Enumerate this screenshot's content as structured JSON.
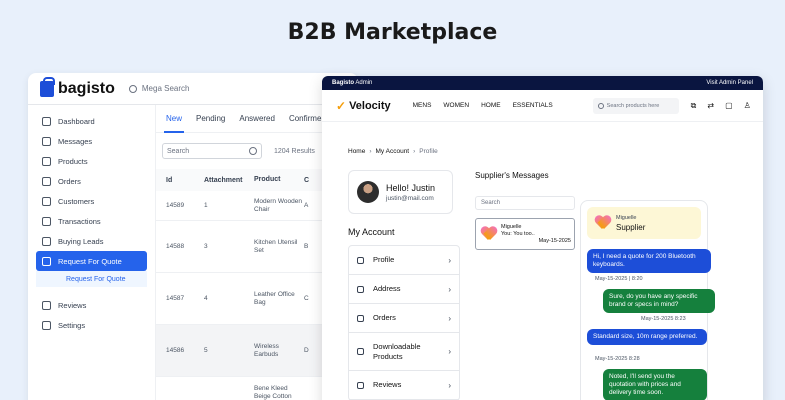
{
  "page": {
    "title": "B2B Marketplace"
  },
  "bagisto": {
    "logo": "bagisto",
    "search_placeholder": "Mega Search",
    "sidebar": [
      {
        "label": "Dashboard",
        "icon": "dashboard-icon"
      },
      {
        "label": "Messages",
        "icon": "message-icon"
      },
      {
        "label": "Products",
        "icon": "box-icon"
      },
      {
        "label": "Orders",
        "icon": "orders-icon"
      },
      {
        "label": "Customers",
        "icon": "users-icon"
      },
      {
        "label": "Transactions",
        "icon": "transactions-icon"
      },
      {
        "label": "Buying Leads",
        "icon": "leads-icon"
      },
      {
        "label": "Request For Quote",
        "icon": "quote-icon",
        "active": true
      }
    ],
    "sidebar_sub": "Request For Quote",
    "sidebar_bottom": [
      {
        "label": "Reviews",
        "icon": "reviews-icon"
      },
      {
        "label": "Settings",
        "icon": "settings-icon"
      }
    ],
    "tabs": [
      "New",
      "Pending",
      "Answered",
      "Confirme"
    ],
    "search_label": "Search",
    "results": "1204 Results",
    "columns": [
      "Id",
      "Attachment",
      "Product",
      "C"
    ],
    "rows": [
      {
        "id": "14589",
        "attachment": "1",
        "product": "Modern Wooden Chair",
        "co": "A"
      },
      {
        "id": "14588",
        "attachment": "3",
        "product": "Kitchen Utensil Set",
        "co": "B"
      },
      {
        "id": "14587",
        "attachment": "4",
        "product": "Leather Office Bag",
        "co": "C"
      },
      {
        "id": "14586",
        "attachment": "5",
        "product": "Wireless Earbuds",
        "co": "D"
      },
      {
        "id": "",
        "attachment": "",
        "product": "Bene Kleed Beige Cotton Straight",
        "co": ""
      }
    ]
  },
  "velocity": {
    "admin_bar_brand": "Bagisto",
    "admin_bar_label": "Admin",
    "admin_bar_link": "Visit Admin Panel",
    "logo": "Velocity",
    "nav": [
      "MENS",
      "WOMEN",
      "HOME",
      "ESSENTIALS"
    ],
    "search_placeholder": "Search products here",
    "breadcrumb": [
      "Home",
      "My Account",
      "Profile"
    ],
    "profile": {
      "greeting": "Hello! Justin",
      "email": "justin@mail.com"
    },
    "my_account_title": "My Account",
    "account_items": [
      "Profile",
      "Address",
      "Orders",
      "Downloadable Products",
      "Reviews"
    ],
    "supplier_title": "Supplier's Messages",
    "supplier_search": "Search",
    "supplier_card": {
      "name": "Miguelle",
      "preview": "You: You too..",
      "date": "May-15-2025"
    },
    "chat_head": {
      "name": "Miguelle",
      "role": "Supplier"
    },
    "messages": [
      {
        "text": "Hi, I need a quote for 200 Bluetooth keyboards.",
        "time": "May-15-2025 | 8:20",
        "side": "left"
      },
      {
        "text": "Sure, do you have any specific brand or specs in mind?",
        "time": "May-15-2025 8:23",
        "side": "right"
      },
      {
        "text": "Standard size, 10m range preferred.",
        "time": "May-15-2025 8:28",
        "side": "left"
      },
      {
        "text": "Noted, I'll send you the quotation with prices and delivery time soon.",
        "time": "",
        "side": "right"
      }
    ],
    "colors": {
      "admin_bar": "#0a1540",
      "sent": "#1d4ed8",
      "received": "#15803d"
    }
  }
}
